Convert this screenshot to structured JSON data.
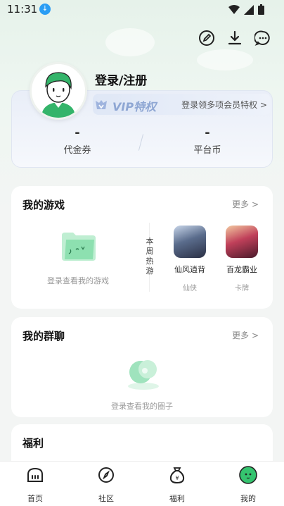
{
  "status_bar": {
    "time": "11:31"
  },
  "profile": {
    "login_title": "登录/注册",
    "vip_label": "VIP特权",
    "vip_desc": "登录领多项会员特权 >",
    "stats": [
      {
        "value": "-",
        "label": "代金券"
      },
      {
        "value": "-",
        "label": "平台币"
      }
    ]
  },
  "my_games": {
    "title": "我的游戏",
    "more": "更多 >",
    "empty_text": "登录查看我的游戏",
    "hot_label": "本周热游",
    "games": [
      {
        "name": "仙风逍背",
        "tag": "仙侠",
        "color": "#3a4660"
      },
      {
        "name": "百龙霸业",
        "tag": "卡牌",
        "color": "#7a2a3a"
      }
    ]
  },
  "my_groups": {
    "title": "我的群聊",
    "more": "更多 >",
    "empty_text": "登录查看我的圈子"
  },
  "benefits": {
    "title": "福利"
  },
  "bottom_nav": [
    {
      "label": "首页",
      "icon": "home-icon"
    },
    {
      "label": "社区",
      "icon": "compass-icon"
    },
    {
      "label": "福利",
      "icon": "money-bag-icon"
    },
    {
      "label": "我的",
      "icon": "profile-face-icon"
    }
  ],
  "colors": {
    "accent": "#35c46f",
    "vip": "#8ea6d3"
  }
}
